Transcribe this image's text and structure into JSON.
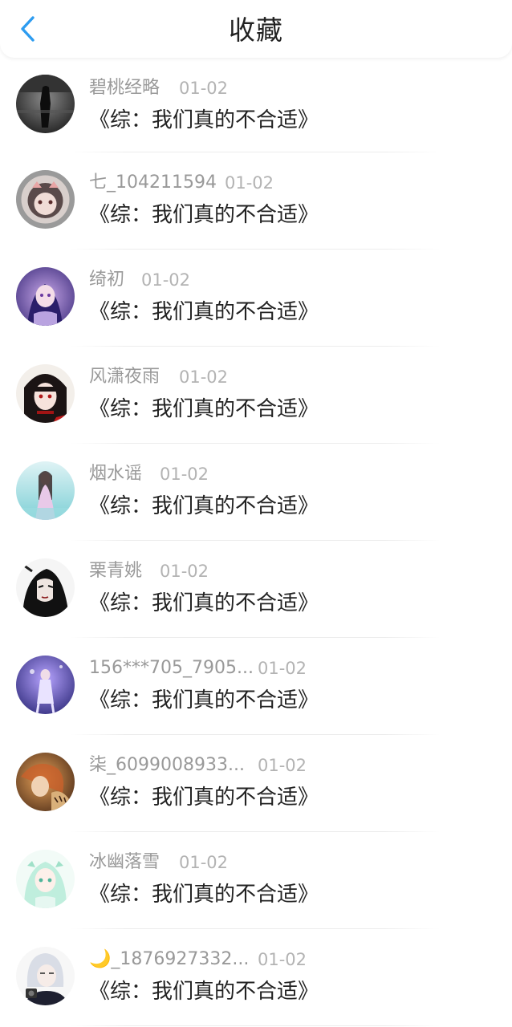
{
  "header": {
    "title": "收藏",
    "back_icon": "chevron-left-icon",
    "accent_color": "#2d9cf0"
  },
  "items": [
    {
      "user": "碧桃经略",
      "date": "01-02",
      "book": "《综：我们真的不合适》"
    },
    {
      "user": "七_104211594",
      "date": "01-02",
      "book": "《综：我们真的不合适》"
    },
    {
      "user": "绮初",
      "date": "01-02",
      "book": "《综：我们真的不合适》"
    },
    {
      "user": "风潇夜雨",
      "date": "01-02",
      "book": "《综：我们真的不合适》"
    },
    {
      "user": "烟水谣",
      "date": "01-02",
      "book": "《综：我们真的不合适》"
    },
    {
      "user": "栗青姚",
      "date": "01-02",
      "book": "《综：我们真的不合适》"
    },
    {
      "user": "156***705_7905...",
      "date": "01-02",
      "book": "《综：我们真的不合适》"
    },
    {
      "user": "柒_6099008933...",
      "date": "01-02",
      "book": "《综：我们真的不合适》"
    },
    {
      "user": "冰幽落雪",
      "date": "01-02",
      "book": "《综：我们真的不合适》"
    },
    {
      "user": "🌙_1876927332...",
      "date": "01-02",
      "book": "《综：我们真的不合适》"
    }
  ]
}
